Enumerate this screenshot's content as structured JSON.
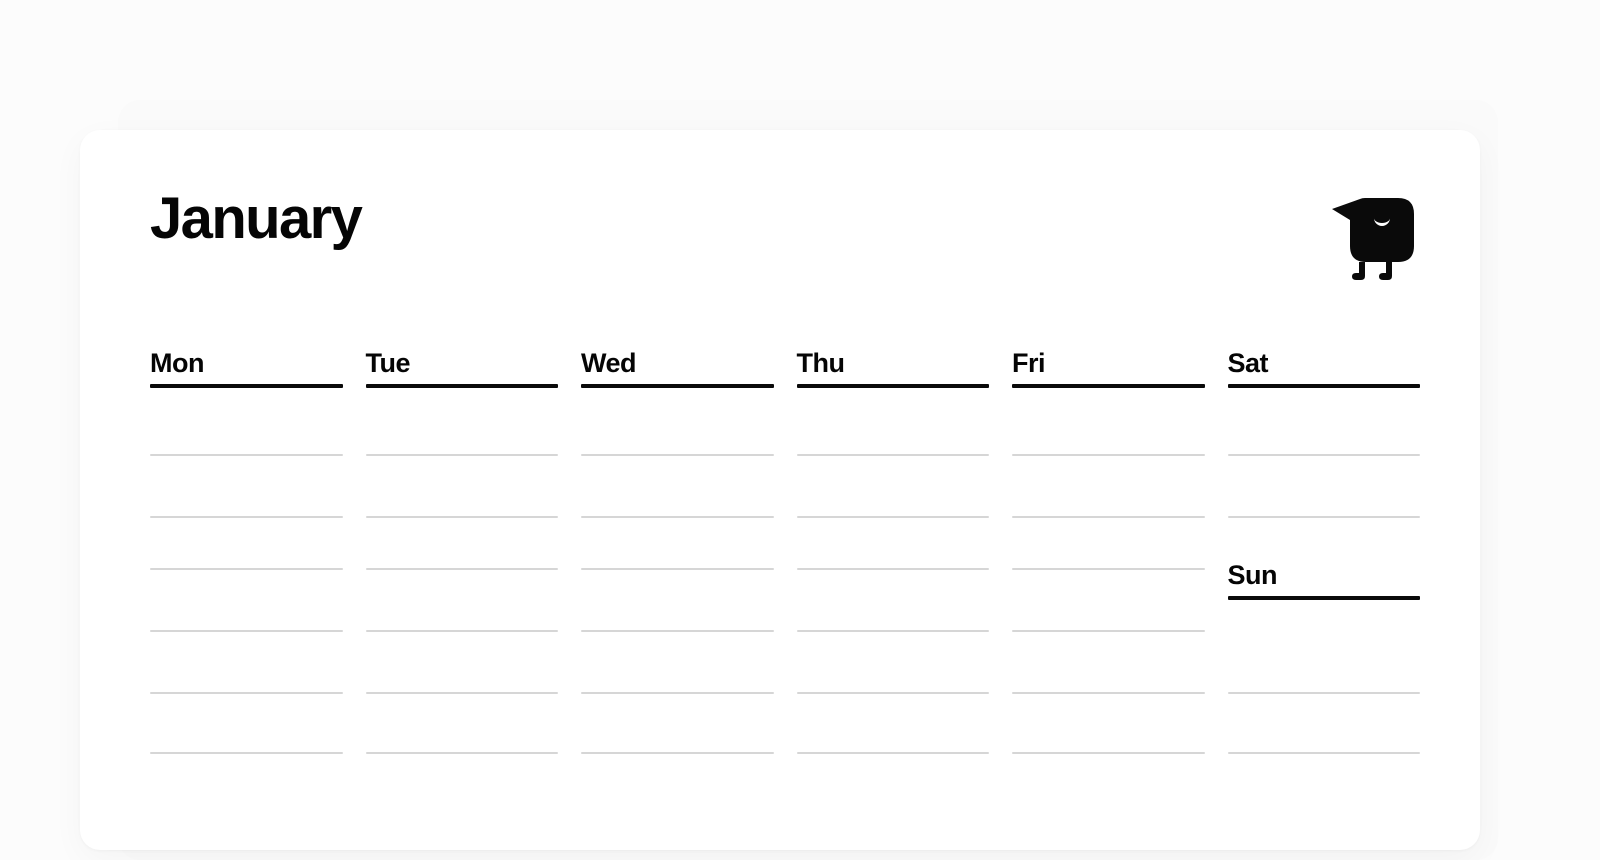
{
  "page": {
    "background_color": "#fcfcfc",
    "card_background_color": "#ffffff"
  },
  "header": {
    "month_title": "January",
    "logo_name": "bird-logo",
    "logo_color": "#0a0a0a"
  },
  "calendar": {
    "rule_strong_color": "#0a0a0a",
    "rule_light_color": "#d6d6d6",
    "weekday_columns": [
      {
        "label": "Mon",
        "ruled_lines": 6
      },
      {
        "label": "Tue",
        "ruled_lines": 6
      },
      {
        "label": "Wed",
        "ruled_lines": 6
      },
      {
        "label": "Thu",
        "ruled_lines": 6
      },
      {
        "label": "Fri",
        "ruled_lines": 6
      }
    ],
    "weekend_column": {
      "saturday": {
        "label": "Sat",
        "ruled_lines": 2
      },
      "sunday": {
        "label": "Sun",
        "ruled_lines": 2
      }
    }
  }
}
